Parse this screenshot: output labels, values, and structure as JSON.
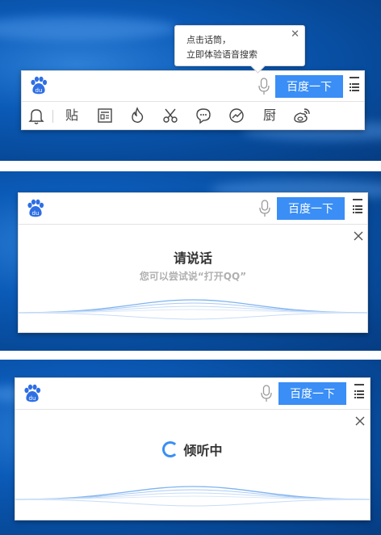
{
  "tooltip": {
    "line1": "点击话筒，",
    "line2": "立即体验语音搜索",
    "close": "✕"
  },
  "searchbar": {
    "button_label": "百度一下"
  },
  "toolbar": {
    "tie_label": "贴",
    "cook_label": "厨",
    "items": [
      "bell-icon",
      "tieba-icon",
      "news-icon",
      "fire-icon",
      "scissors-icon",
      "chat-icon",
      "chart-icon",
      "cook-icon",
      "weibo-icon"
    ]
  },
  "voice": {
    "title": "请说话",
    "hint": "您可以尝试说“打开QQ”",
    "close": "✕"
  },
  "listening": {
    "text": "倾听中",
    "close": "✕"
  },
  "colors": {
    "accent": "#3a8ef6",
    "desktop": "#0b5bb8"
  }
}
